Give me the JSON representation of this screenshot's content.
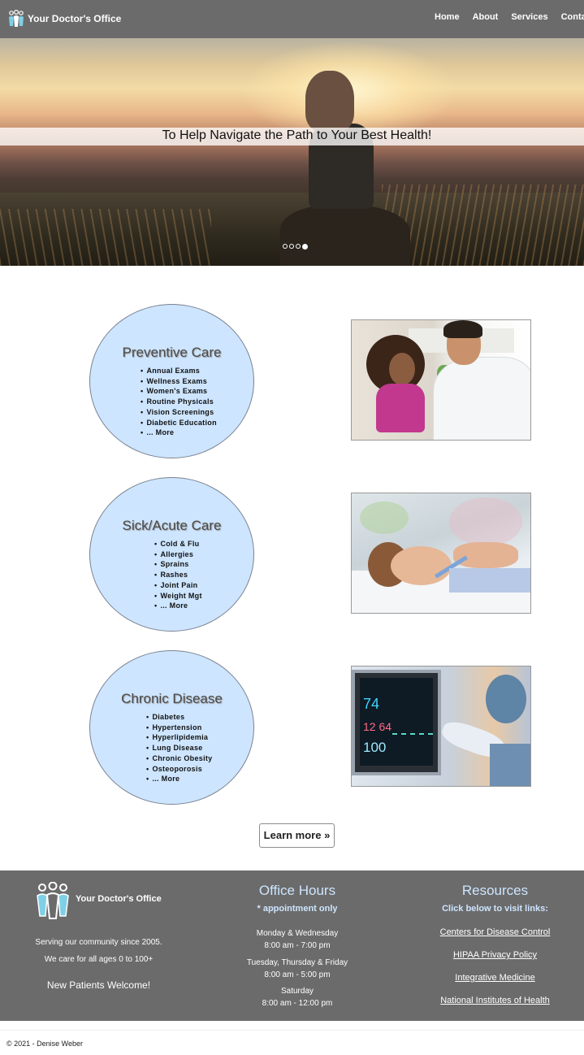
{
  "nav": {
    "brand": "Your Doctor's Office",
    "links": [
      "Home",
      "About",
      "Services",
      "Contact"
    ]
  },
  "hero": {
    "caption": "To Help Navigate the Path to Your Best Health!",
    "slides": 4,
    "active_slide": 4
  },
  "services": [
    {
      "title": "Preventive Care",
      "items": [
        "Annual Exams",
        "Wellness Exams",
        "Women's Exams",
        "Routine Physicals",
        "Vision Screenings",
        "Diabetic Education",
        "... More"
      ]
    },
    {
      "title": "Sick/Acute Care",
      "items": [
        "Cold & Flu",
        "Allergies",
        "Sprains",
        "Rashes",
        "Joint Pain",
        "Weight Mgt",
        "... More"
      ]
    },
    {
      "title": "Chronic Disease",
      "items": [
        "Diabetes",
        "Hypertension",
        "Hyperlipidemia",
        "Lung Disease",
        "Chronic Obesity",
        "Osteoporosis",
        "... More"
      ]
    }
  ],
  "photo_monitor": {
    "v1": "74",
    "v2": "12 64",
    "v3": "100"
  },
  "learn_more": "Learn more »",
  "footer": {
    "brand": "Your Doctor's Office",
    "tagline1": "Serving our community since 2005.",
    "tagline2": "We care for all ages 0 to 100+",
    "welcome": "New Patients Welcome!",
    "hours_title": "Office Hours",
    "hours_note": "* appointment only",
    "hours": [
      {
        "days": "Monday & Wednesday",
        "time": "8:00 am - 7:00 pm"
      },
      {
        "days": "Tuesday, Thursday & Friday",
        "time": "8:00 am - 5:00 pm"
      },
      {
        "days": "Saturday",
        "time": "8:00 am - 12:00 pm"
      }
    ],
    "resources_title": "Resources",
    "resources_note": "Click below to visit links:",
    "resources": [
      "Centers for Disease Control",
      "HIPAA Privacy Policy",
      "Integrative Medicine",
      "National Institutes of Health"
    ]
  },
  "copyright": "© 2021 - Denise Weber",
  "colors": {
    "nav_bg": "#6b6b6b",
    "circle_bg": "#cde5ff",
    "footer_accent": "#cde5ff"
  }
}
